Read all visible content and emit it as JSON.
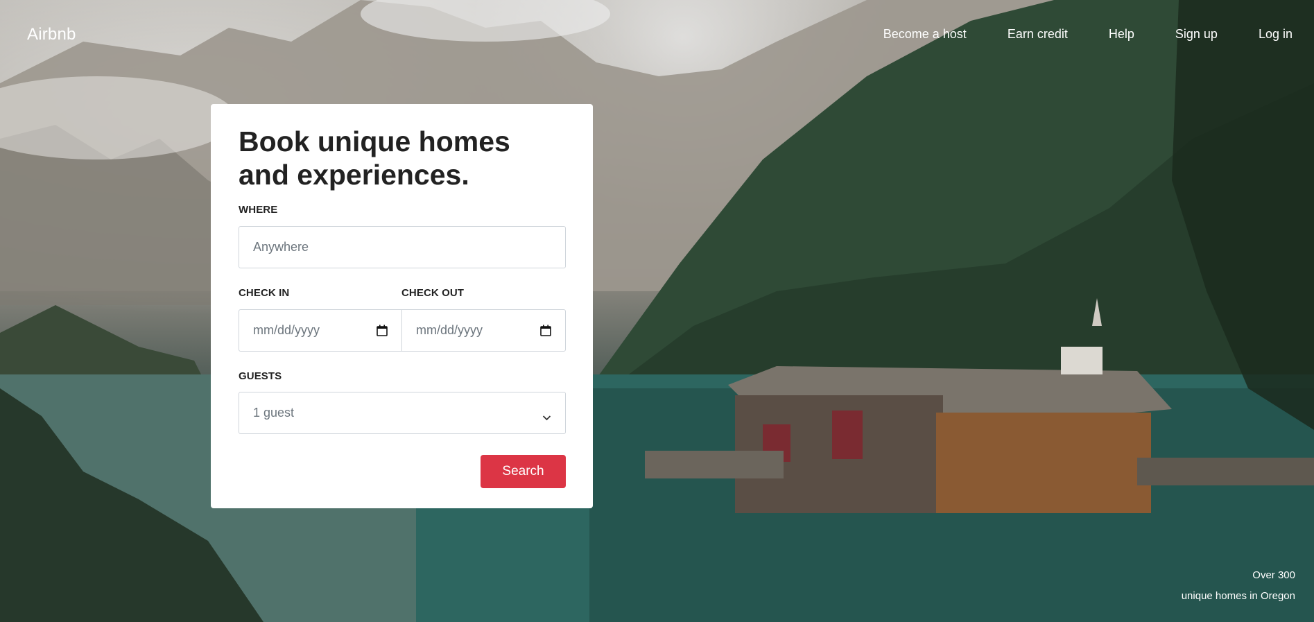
{
  "nav": {
    "brand": "Airbnb",
    "links": [
      {
        "label": "Become a host"
      },
      {
        "label": "Earn credit"
      },
      {
        "label": "Help"
      },
      {
        "label": "Sign up"
      },
      {
        "label": "Log in"
      }
    ]
  },
  "booking": {
    "title": "Book unique homes and experiences.",
    "where_label": "WHERE",
    "where_placeholder": "Anywhere",
    "checkin_label": "CHECK IN",
    "checkin_placeholder": "mm/dd/yyyy",
    "checkout_label": "CHECK OUT",
    "checkout_placeholder": "mm/dd/yyyy",
    "guests_label": "GUESTS",
    "guests_value": "1 guest",
    "search_label": "Search"
  },
  "caption": {
    "line1": "Over 300",
    "line2": "unique homes in Oregon"
  },
  "colors": {
    "accent": "#dc3545",
    "card_bg": "#ffffff",
    "text": "#222222"
  },
  "icons": {
    "calendar": "calendar-icon",
    "chevron": "chevron-down-icon"
  }
}
